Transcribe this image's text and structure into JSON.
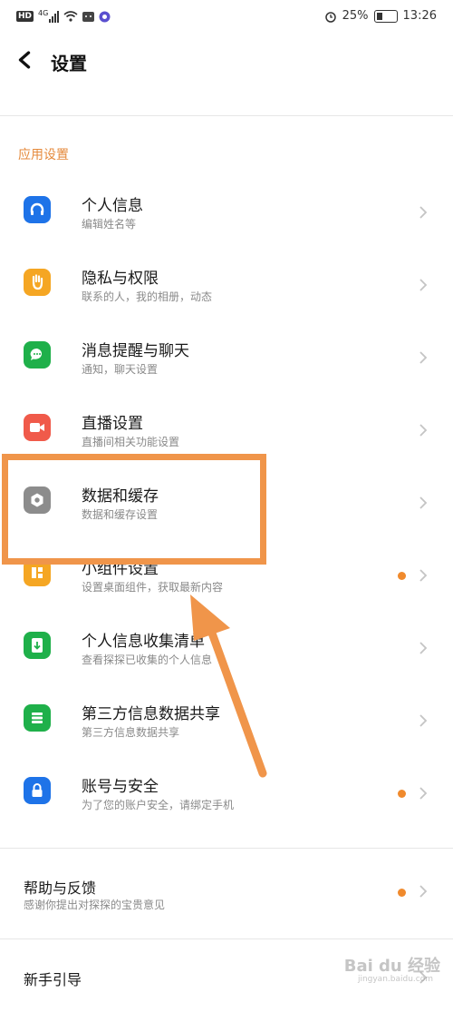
{
  "status_bar": {
    "network": "HD",
    "signal_type": "4G",
    "battery": "25%",
    "time": "13:26"
  },
  "header": {
    "title": "设置",
    "back_icon": "chevron-left-icon"
  },
  "section": {
    "title": "应用设置"
  },
  "rows": [
    {
      "label": "个人信息",
      "sub": "编辑姓名等",
      "icon_color": "#1e73e8",
      "icon": "headset-icon",
      "dot": false
    },
    {
      "label": "隐私与权限",
      "sub": "联系的人，我的相册，动态",
      "icon_color": "#f5a623",
      "icon": "hand-icon",
      "dot": false
    },
    {
      "label": "消息提醒与聊天",
      "sub": "通知，聊天设置",
      "icon_color": "#1fb04a",
      "icon": "chat-icon",
      "dot": false
    },
    {
      "label": "直播设置",
      "sub": "直播间相关功能设置",
      "icon_color": "#f05a4a",
      "icon": "video-icon",
      "dot": false
    },
    {
      "label": "数据和缓存",
      "sub": "数据和缓存设置",
      "icon_color": "#8c8c8c",
      "icon": "gear-icon",
      "dot": false
    },
    {
      "label": "小组件设置",
      "sub": "设置桌面组件，获取最新内容",
      "icon_color": "#f5a623",
      "icon": "widget-icon",
      "dot": true
    },
    {
      "label": "个人信息收集清单",
      "sub": "查看探探已收集的个人信息",
      "icon_color": "#1fb04a",
      "icon": "download-icon",
      "dot": false
    },
    {
      "label": "第三方信息数据共享",
      "sub": "第三方信息数据共享",
      "icon_color": "#1fb04a",
      "icon": "list-icon",
      "dot": false
    },
    {
      "label": "账号与安全",
      "sub": "为了您的账户安全，请绑定手机",
      "icon_color": "#1e73e8",
      "icon": "lock-icon",
      "dot": true
    }
  ],
  "help": {
    "label": "帮助与反馈",
    "sub": "感谢你提出对探探的宝贵意见",
    "dot": true
  },
  "guide": {
    "label": "新手引导"
  },
  "watermark": {
    "main": "Bai du 经验",
    "sub": "jingyan.baidu.com"
  },
  "colors": {
    "accent": "#e58a3c",
    "annotation": "#f0954a",
    "dot": "#f08a2d"
  }
}
